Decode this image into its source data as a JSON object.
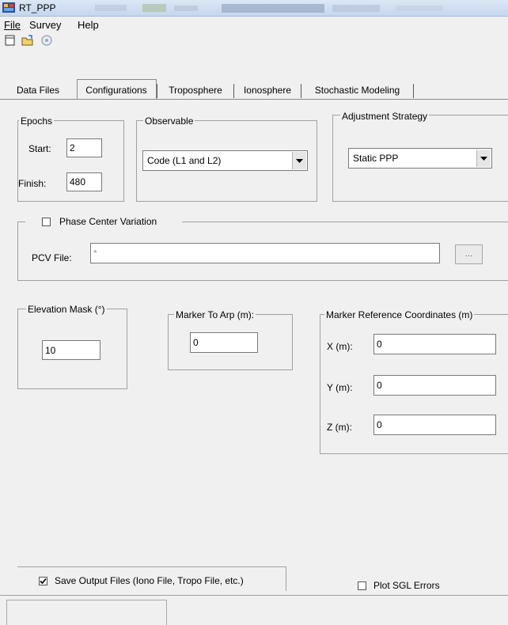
{
  "window": {
    "title": "RT_PPP"
  },
  "menu": {
    "file": "File",
    "survey": "Survey",
    "help": "Help"
  },
  "toolbar": {
    "icons": [
      "new-file-icon",
      "open-folder-icon",
      "run-disc-icon"
    ]
  },
  "tabs": [
    {
      "label": "Data Files",
      "active": false
    },
    {
      "label": "Configurations",
      "active": true
    },
    {
      "label": "Troposphere",
      "active": false
    },
    {
      "label": "Ionosphere",
      "active": false
    },
    {
      "label": "Stochastic Modeling",
      "active": false
    }
  ],
  "epochs": {
    "title": "Epochs",
    "start_label": "Start:",
    "start_value": "2",
    "finish_label": "Finish:",
    "finish_value": "480"
  },
  "observable": {
    "title": "Observable",
    "selected": "Code (L1 and L2)"
  },
  "adjustment": {
    "title": "Adjustment Strategy",
    "selected": "Static PPP"
  },
  "pcv": {
    "checkbox_label": "Phase Center Variation",
    "checked": false,
    "file_label": "PCV File:",
    "file_value": "*",
    "browse_label": "..."
  },
  "elevation": {
    "title": "Elevation Mask (°)",
    "value": "10"
  },
  "marker_arp": {
    "title": "Marker To Arp (m):",
    "value": "0"
  },
  "marker_ref": {
    "title": "Marker Reference Coordinates (m)",
    "x_label": "X (m):",
    "x_value": "0",
    "y_label": "Y (m):",
    "y_value": "0",
    "z_label": "Z (m):",
    "z_value": "0"
  },
  "save_output": {
    "label": "Save Output Files (Iono File, Tropo File, etc.)",
    "checked": true
  },
  "plot_sgl": {
    "label": "Plot SGL Errors",
    "checked": false
  },
  "colors": {
    "titlebar": "#c4d6ee",
    "window_bg": "#f0f0f0",
    "border": "#a0a0a0"
  }
}
